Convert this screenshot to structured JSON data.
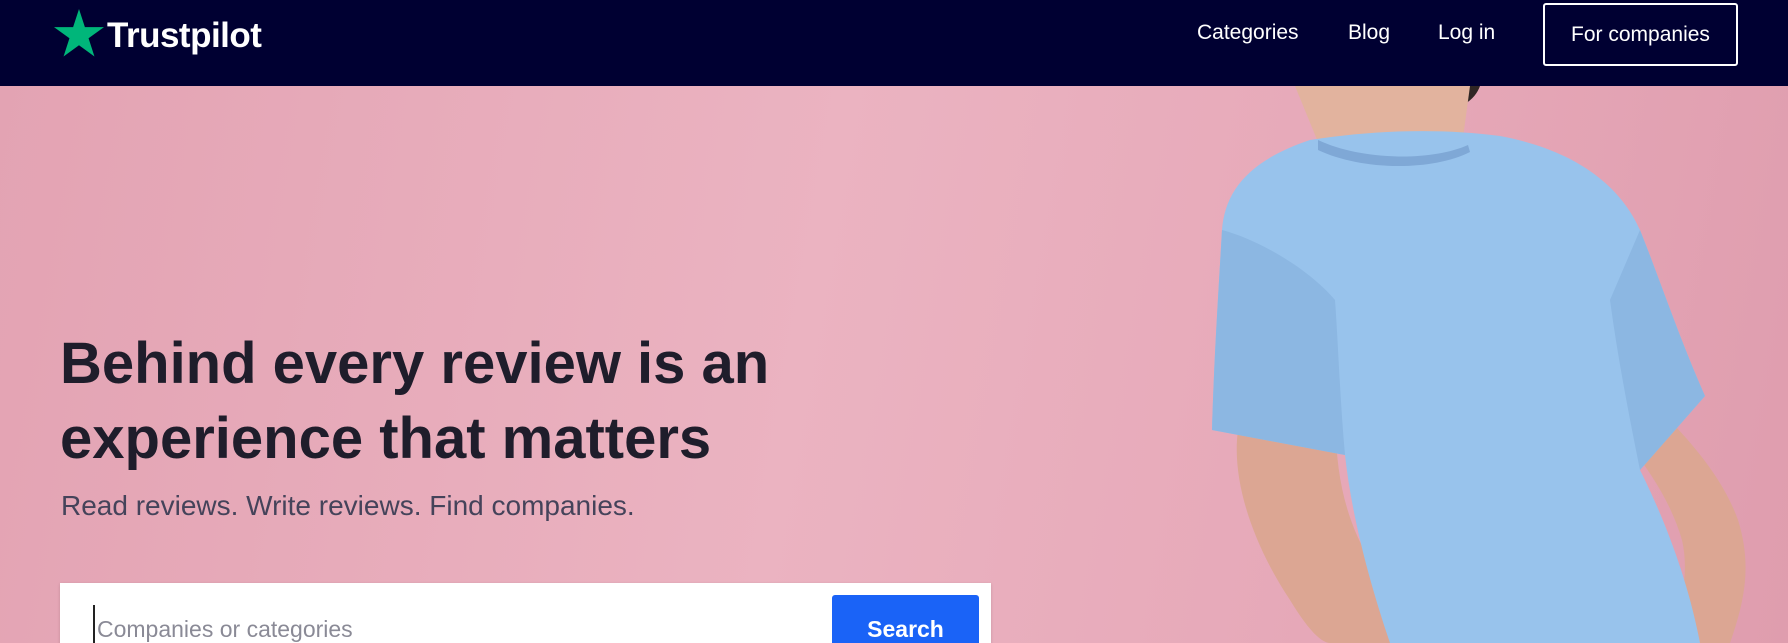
{
  "header": {
    "logo": {
      "icon": "star-icon",
      "text": "Trustpilot",
      "star_color": "#00b67a"
    },
    "nav": {
      "categories": "Categories",
      "blog": "Blog",
      "login": "Log in",
      "for_companies": "For companies"
    },
    "background": "#000032"
  },
  "hero": {
    "headline": "Behind every review is an experience that matters",
    "subhead": "Read reviews. Write reviews. Find companies.",
    "search": {
      "value": "",
      "placeholder": "Companies or categories",
      "button_label": "Search",
      "button_color": "#1a63f7"
    },
    "background": "#e4a6b5",
    "image": "person-in-blue-tshirt"
  }
}
